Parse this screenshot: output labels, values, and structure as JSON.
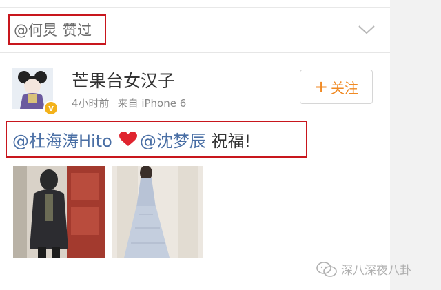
{
  "liked": {
    "mention": "@何炅",
    "action": "赞过"
  },
  "post": {
    "username": "芒果台女汉子",
    "time": "4小时前",
    "source": "来自 iPhone 6",
    "follow_label": "关注",
    "follow_plus": "+",
    "verified_badge": "v",
    "text": {
      "mention1": "@杜海涛Hito",
      "mention2": "@沈梦辰",
      "suffix": "祝福!"
    }
  },
  "watermark": "深八深夜八卦",
  "icons": [
    "chevron-down-icon",
    "heart-icon",
    "verified-badge-icon",
    "wechat-icon"
  ],
  "colors": {
    "highlight_border": "#c8161d",
    "mention": "#4a6fa5",
    "follow": "#f08a24",
    "badge": "#f3b21b",
    "heart": "#e0242f"
  }
}
